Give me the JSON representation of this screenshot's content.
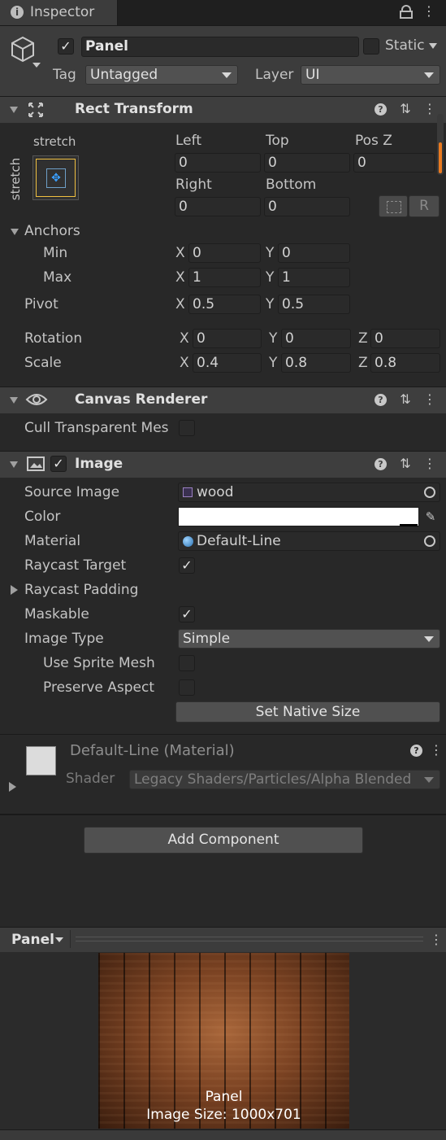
{
  "tab": {
    "title": "Inspector"
  },
  "go": {
    "name": "Panel",
    "static_label": "Static",
    "tag_label": "Tag",
    "tag": "Untagged",
    "layer_label": "Layer",
    "layer": "UI"
  },
  "rect": {
    "title": "Rect Transform",
    "stretch_h": "stretch",
    "stretch_v": "stretch",
    "left_label": "Left",
    "left": "0",
    "top_label": "Top",
    "top": "0",
    "posz_label": "Pos Z",
    "posz": "0",
    "right_label": "Right",
    "right": "0",
    "bottom_label": "Bottom",
    "bottom": "0",
    "r_button": "R",
    "anchors_label": "Anchors",
    "min_label": "Min",
    "min_x": "0",
    "min_y": "0",
    "max_label": "Max",
    "max_x": "1",
    "max_y": "1",
    "pivot_label": "Pivot",
    "pivot_x": "0.5",
    "pivot_y": "0.5",
    "rotation_label": "Rotation",
    "rot_x": "0",
    "rot_y": "0",
    "rot_z": "0",
    "scale_label": "Scale",
    "scale_x": "0.4",
    "scale_y": "0.8",
    "scale_z": "0.8",
    "x": "X",
    "y": "Y",
    "z": "Z"
  },
  "canvas_renderer": {
    "title": "Canvas Renderer",
    "cull_label": "Cull Transparent Mes"
  },
  "image": {
    "title": "Image",
    "source_label": "Source Image",
    "source": "wood",
    "color_label": "Color",
    "color_value": "#ffffff",
    "material_label": "Material",
    "material": "Default-Line",
    "raycast_label": "Raycast Target",
    "padding_label": "Raycast Padding",
    "maskable_label": "Maskable",
    "type_label": "Image Type",
    "type": "Simple",
    "sprite_mesh_label": "Use Sprite Mesh",
    "preserve_label": "Preserve Aspect",
    "native_button": "Set Native Size"
  },
  "material": {
    "title": "Default-Line (Material)",
    "shader_label": "Shader",
    "shader": "Legacy Shaders/Particles/Alpha Blended"
  },
  "add_component": "Add Component",
  "preview": {
    "title": "Panel",
    "caption_name": "Panel",
    "caption_size": "Image Size: 1000x701"
  },
  "check_glyph": "✓",
  "colors": {
    "accent": "#e97a20",
    "header": "#3e3e3e",
    "panel": "#282828",
    "field": "#2a2a2a"
  }
}
